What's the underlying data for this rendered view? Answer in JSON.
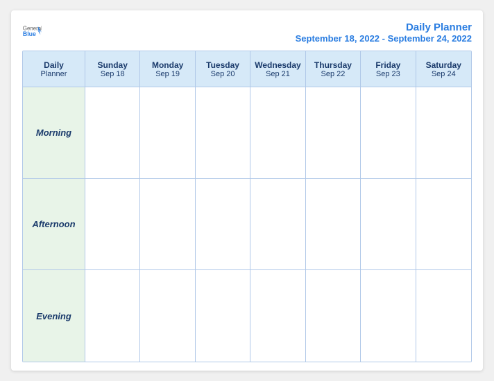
{
  "header": {
    "logo_general": "General",
    "logo_blue": "Blue",
    "title_main": "Daily Planner",
    "title_sub": "September 18, 2022 - September 24, 2022"
  },
  "columns": [
    {
      "id": "label",
      "day": "Daily",
      "date": "Planner"
    },
    {
      "id": "sun",
      "day": "Sunday",
      "date": "Sep 18"
    },
    {
      "id": "mon",
      "day": "Monday",
      "date": "Sep 19"
    },
    {
      "id": "tue",
      "day": "Tuesday",
      "date": "Sep 20"
    },
    {
      "id": "wed",
      "day": "Wednesday",
      "date": "Sep 21"
    },
    {
      "id": "thu",
      "day": "Thursday",
      "date": "Sep 22"
    },
    {
      "id": "fri",
      "day": "Friday",
      "date": "Sep 23"
    },
    {
      "id": "sat",
      "day": "Saturday",
      "date": "Sep 24"
    }
  ],
  "rows": [
    {
      "label": "Morning"
    },
    {
      "label": "Afternoon"
    },
    {
      "label": "Evening"
    }
  ]
}
